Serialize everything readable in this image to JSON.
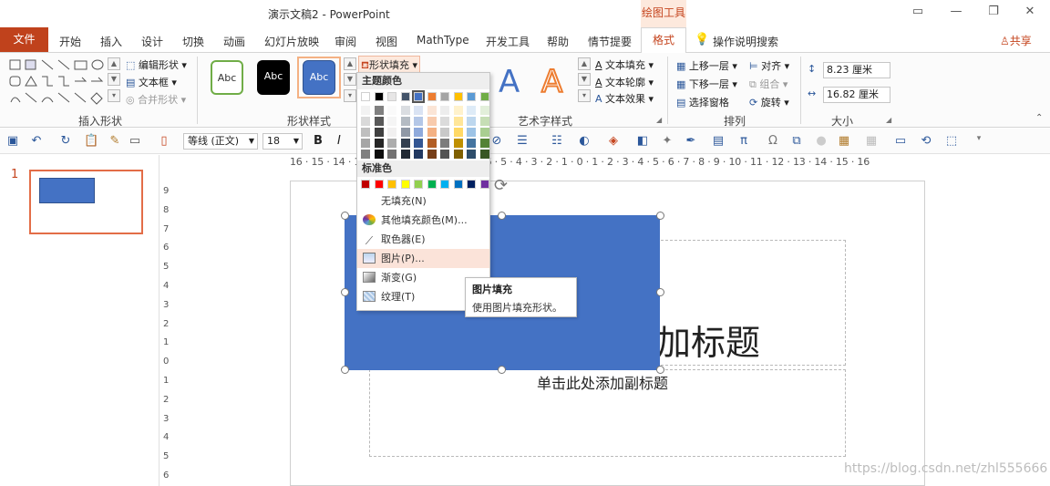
{
  "window": {
    "title": "演示文稿2  -  PowerPoint",
    "context_tab_group": "绘图工具",
    "controls": [
      "restore-ribbon-icon",
      "minimize-icon",
      "maximize-icon",
      "close-icon"
    ]
  },
  "tabs": {
    "file": "文件",
    "items": [
      "开始",
      "插入",
      "设计",
      "切换",
      "动画",
      "幻灯片放映",
      "审阅",
      "视图",
      "MathType",
      "开发工具",
      "帮助",
      "情节提要"
    ],
    "active": "格式",
    "tell_me": "操作说明搜索",
    "share": "共享"
  },
  "ribbon": {
    "insert_shapes": {
      "label": "插入形状",
      "edit_shape": "编辑形状",
      "text_box": "文本框",
      "merge_shapes": "合并形状"
    },
    "shape_styles": {
      "label": "形状样式",
      "style_samples": [
        "Abc",
        "Abc",
        "Abc"
      ],
      "shape_fill": "形状填充"
    },
    "wordart": {
      "label": "艺术字样式",
      "text_fill": "文本填充",
      "text_outline": "文本轮廓",
      "text_effects": "文本效果",
      "sample_letters": [
        "A",
        "A",
        "A"
      ]
    },
    "arrange": {
      "label": "排列",
      "bring_forward": "上移一层",
      "send_backward": "下移一层",
      "selection_pane": "选择窗格",
      "align": "对齐",
      "group": "组合",
      "rotate": "旋转"
    },
    "size": {
      "label": "大小",
      "height": "8.23 厘米",
      "width": "16.82 厘米"
    }
  },
  "format_bar": {
    "font": "等线 (正文)",
    "size": "18",
    "bold": "B",
    "italic": "I"
  },
  "slides_pane": {
    "slide_number": "1"
  },
  "ruler": {
    "horizontal": "16 · 15 · 14 · 13 · 12 · 11 · 10 · 9 · 8 · 7 · 6 · 5 · 4 · 3 · 2 · 1 · 0 · 1 · 2 · 3 · 4 · 5 · 6 · 7 · 8 · 9 · 10 · 11 · 12 · 13 · 14 · 15 · 16",
    "vertical": [
      "9",
      "8",
      "7",
      "6",
      "5",
      "4",
      "3",
      "2",
      "1",
      "0",
      "1",
      "2",
      "3",
      "4",
      "5",
      "6"
    ]
  },
  "slide": {
    "title_placeholder_visible": "加标题",
    "subtitle_placeholder": "单击此处添加副标题"
  },
  "fill_menu": {
    "theme_colors": "主题颜色",
    "standard_colors": "标准色",
    "no_fill": "无填充(N)",
    "more_fill_colors": "其他填充颜色(M)...",
    "eyedropper": "取色器(E)",
    "picture": "图片(P)...",
    "gradient": "渐变(G)",
    "texture": "纹理(T)",
    "theme_top": [
      "#ffffff",
      "#000000",
      "#e7e6e6",
      "#44546a",
      "#4472c4",
      "#ed7d31",
      "#a5a5a5",
      "#ffc000",
      "#5b9bd5",
      "#70ad47"
    ],
    "standard": [
      "#c00000",
      "#ff0000",
      "#ffc000",
      "#ffff00",
      "#92d050",
      "#00b050",
      "#00b0f0",
      "#0070c0",
      "#002060",
      "#7030a0"
    ]
  },
  "tooltip": {
    "title": "图片填充",
    "description": "使用图片填充形状。"
  },
  "watermark": "https://blog.csdn.net/zhl555666"
}
